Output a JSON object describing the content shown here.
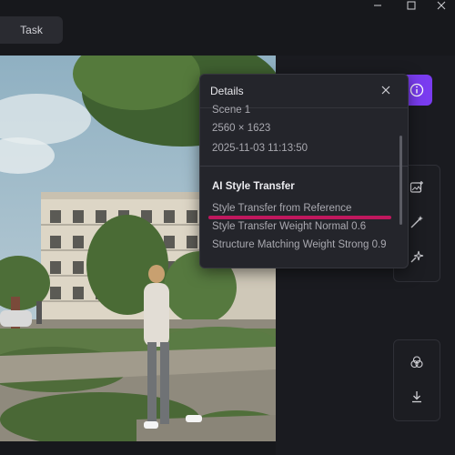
{
  "window": {
    "minimize_icon": "minimize-icon",
    "maximize_icon": "maximize-icon",
    "close_icon": "close-icon"
  },
  "tabs": [
    {
      "label": "Task"
    }
  ],
  "details": {
    "title": "Details",
    "scene": "Scene 1",
    "resolution": "2560 × 1623",
    "timestamp": "2025-11-03 11:13:50",
    "section_title": "AI Style Transfer",
    "rows": [
      "Style Transfer from Reference",
      "Style Transfer Weight Normal 0.6",
      "Structure Matching Weight Strong 0.9"
    ]
  },
  "colors": {
    "accent": "#7a3cf0",
    "highlight": "#c0185e",
    "background": "#17181c"
  },
  "toolbar": {
    "icons": [
      "image-add-icon",
      "magic-wand-icon",
      "sparkle-pin-icon"
    ]
  },
  "toolbar2": {
    "icons": [
      "layers-icon",
      "download-icon"
    ]
  }
}
